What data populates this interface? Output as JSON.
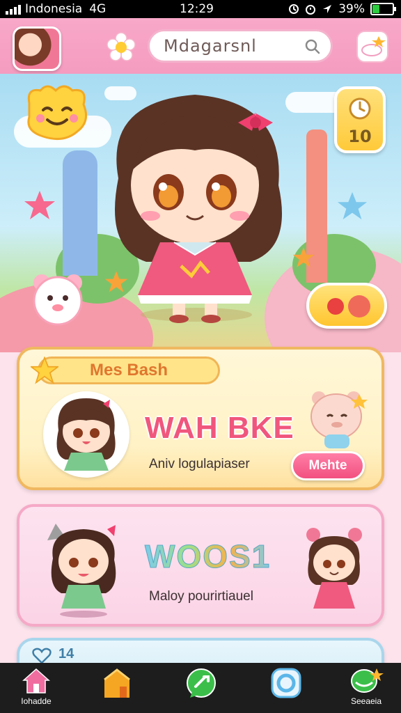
{
  "status_bar": {
    "carrier": "Indonesia",
    "network": "4G",
    "time": "12:29",
    "battery_text": "39%",
    "battery_level": 0.39
  },
  "top_bar": {
    "search_value": "Mdagarsnl"
  },
  "hero": {
    "counter_value": "10"
  },
  "cards": [
    {
      "tag": "Mes Bash",
      "heading": "WAH BKE",
      "subtitle": "Aniv logulapiaser",
      "button": "Mehte"
    },
    {
      "heading": "WOOS1",
      "subtitle": "Maloy pourirtiauel"
    },
    {
      "count": "14"
    }
  ],
  "bottom_nav": [
    {
      "label": "Iohadde",
      "icon": "home-icon",
      "color": "#f06da0"
    },
    {
      "label": "",
      "icon": "house-orange-icon",
      "color": "#f5a623"
    },
    {
      "label": "",
      "icon": "chat-icon",
      "color": "#3bbf4a"
    },
    {
      "label": "",
      "icon": "camera-icon",
      "color": "#5bb6e8"
    },
    {
      "label": "Seeaeia",
      "icon": "chat-star-icon",
      "color": "#3bbf4a"
    }
  ],
  "colors": {
    "top_bar": "#f59cc0",
    "accent_pink": "#f0567d",
    "card1_border": "#f0b860",
    "card2_border": "#f5a9c6",
    "nav_background": "#1d1d1d"
  }
}
